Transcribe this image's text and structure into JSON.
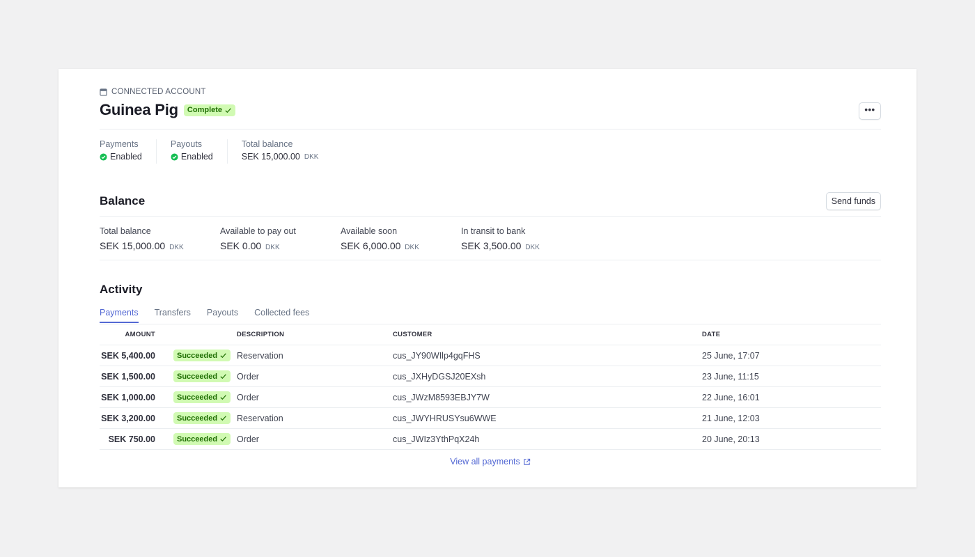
{
  "header": {
    "eyebrow": "CONNECTED ACCOUNT",
    "title": "Guinea Pig",
    "status_badge": "Complete",
    "more_label": "•••"
  },
  "summary": [
    {
      "label": "Payments",
      "value": "Enabled",
      "status_icon": "check-circle-icon"
    },
    {
      "label": "Payouts",
      "value": "Enabled",
      "status_icon": "check-circle-icon"
    },
    {
      "label": "Total balance",
      "value": "SEK 15,000.00",
      "currency": "DKK"
    }
  ],
  "balance": {
    "title": "Balance",
    "send_button": "Send funds",
    "items": [
      {
        "label": "Total balance",
        "value": "SEK 15,000.00",
        "currency": "DKK"
      },
      {
        "label": "Available to pay out",
        "value": "SEK 0.00",
        "currency": "DKK"
      },
      {
        "label": "Available soon",
        "value": "SEK 6,000.00",
        "currency": "DKK"
      },
      {
        "label": "In transit to bank",
        "value": "SEK 3,500.00",
        "currency": "DKK"
      }
    ]
  },
  "activity": {
    "title": "Activity",
    "tabs": [
      "Payments",
      "Transfers",
      "Payouts",
      "Collected fees"
    ],
    "active_tab": 0,
    "columns": {
      "amount": "AMOUNT",
      "description": "DESCRIPTION",
      "customer": "CUSTOMER",
      "date": "DATE"
    },
    "rows": [
      {
        "amount": "SEK 5,400.00",
        "status": "Succeeded",
        "description": "Reservation",
        "customer": "cus_JY90WIlp4gqFHS",
        "date": "25 June, 17:07"
      },
      {
        "amount": "SEK 1,500.00",
        "status": "Succeeded",
        "description": "Order",
        "customer": "cus_JXHyDGSJ20EXsh",
        "date": "23 June, 11:15"
      },
      {
        "amount": "SEK 1,000.00",
        "status": "Succeeded",
        "description": "Order",
        "customer": "cus_JWzM8593EBJY7W",
        "date": "22 June, 16:01"
      },
      {
        "amount": "SEK 3,200.00",
        "status": "Succeeded",
        "description": "Reservation",
        "customer": "cus_JWYHRUSYsu6WWE",
        "date": "21 June, 12:03"
      },
      {
        "amount": "SEK 750.00",
        "status": "Succeeded",
        "description": "Order",
        "customer": "cus_JWIz3YthPqX24h",
        "date": "20 June, 20:13"
      }
    ],
    "view_all": "View all payments"
  },
  "colors": {
    "accent": "#5469d4",
    "success_bg": "#d1fab3",
    "success_text": "#217005",
    "success_icon": "#15be53"
  }
}
